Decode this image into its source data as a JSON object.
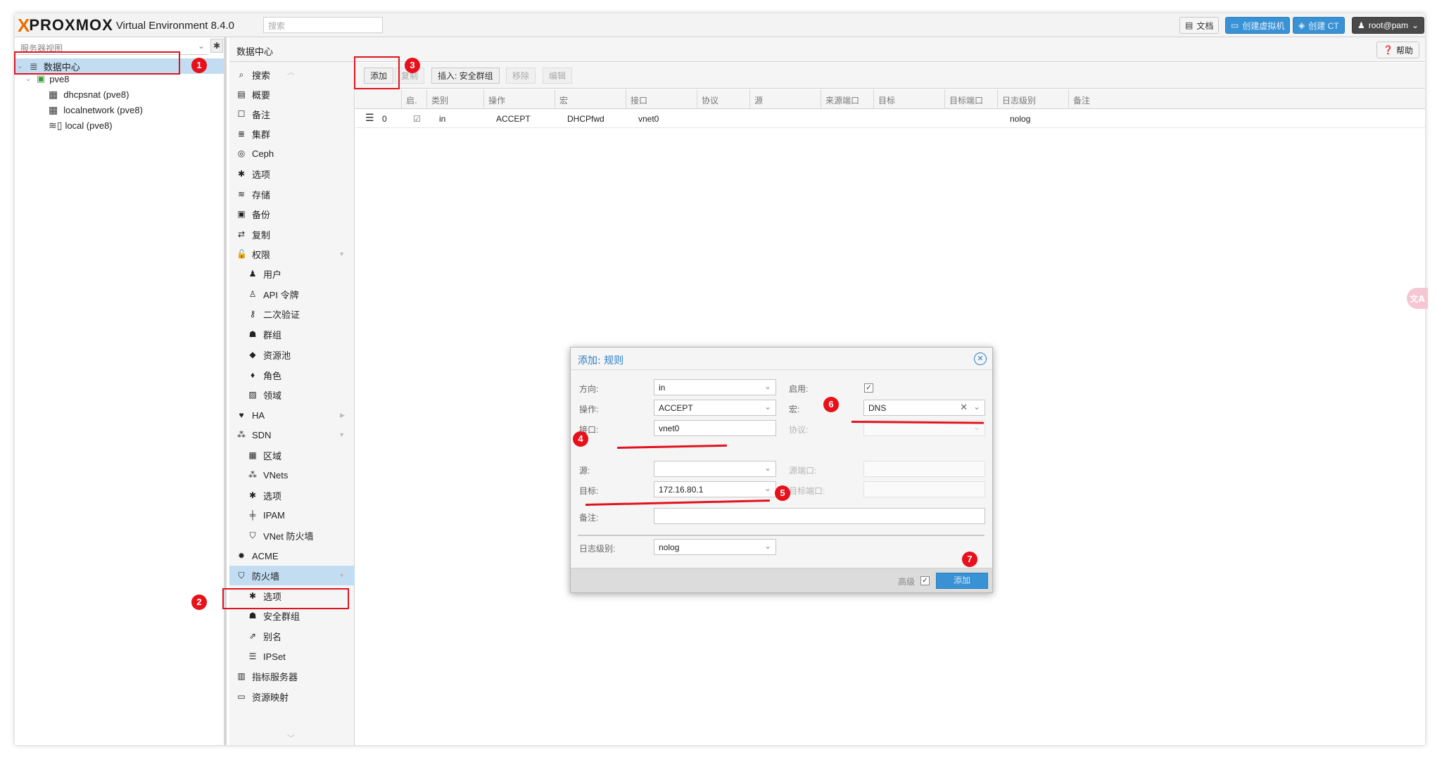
{
  "topbar": {
    "logo_x": "X",
    "logo_text": "PROXMOX",
    "version": "Virtual Environment 8.4.0",
    "search_placeholder": "搜索",
    "docs_label": "文档",
    "create_vm_label": "创建虚拟机",
    "create_ct_label": "创建 CT",
    "user_label": "root@pam"
  },
  "left_tree": {
    "view_label": "服务器视图",
    "items": [
      {
        "label": "数据中心",
        "icon": "datacenter-icon"
      },
      {
        "label": "pve8",
        "icon": "node-icon"
      },
      {
        "label": "dhcpsnat (pve8)",
        "icon": "sdn-zone-icon"
      },
      {
        "label": "localnetwork (pve8)",
        "icon": "sdn-zone-icon"
      },
      {
        "label": "local (pve8)",
        "icon": "storage-icon"
      }
    ]
  },
  "content": {
    "title": "数据中心",
    "help_label": "帮助"
  },
  "nav": {
    "items": [
      {
        "label": "搜索",
        "icon": "search-icon",
        "glyph": "⌕"
      },
      {
        "label": "概要",
        "icon": "book-icon",
        "glyph": "▤"
      },
      {
        "label": "备注",
        "icon": "notes-icon",
        "glyph": "☐"
      },
      {
        "label": "集群",
        "icon": "server-icon",
        "glyph": "≣"
      },
      {
        "label": "Ceph",
        "icon": "ceph-icon",
        "glyph": "◎"
      },
      {
        "label": "选项",
        "icon": "gear-icon",
        "glyph": "✱"
      },
      {
        "label": "存储",
        "icon": "database-icon",
        "glyph": "≋"
      },
      {
        "label": "备份",
        "icon": "floppy-icon",
        "glyph": "▣"
      },
      {
        "label": "复制",
        "icon": "retweet-icon",
        "glyph": "⇄"
      },
      {
        "label": "权限",
        "icon": "unlock-icon",
        "glyph": "🔓"
      },
      {
        "label": "用户",
        "icon": "user-icon",
        "glyph": "♟"
      },
      {
        "label": "API 令牌",
        "icon": "user-outline-icon",
        "glyph": "♙"
      },
      {
        "label": "二次验证",
        "icon": "key-icon",
        "glyph": "⚷"
      },
      {
        "label": "群组",
        "icon": "users-icon",
        "glyph": "☗"
      },
      {
        "label": "资源池",
        "icon": "tags-icon",
        "glyph": "◆"
      },
      {
        "label": "角色",
        "icon": "male-icon",
        "glyph": "♦"
      },
      {
        "label": "领域",
        "icon": "address-book-icon",
        "glyph": "▨"
      },
      {
        "label": "HA",
        "icon": "heartbeat-icon",
        "glyph": "♥"
      },
      {
        "label": "SDN",
        "icon": "sdn-icon",
        "glyph": "⁂"
      },
      {
        "label": "区域",
        "icon": "th-icon",
        "glyph": "▦"
      },
      {
        "label": "VNets",
        "icon": "network-icon",
        "glyph": "⁂"
      },
      {
        "label": "选项",
        "icon": "gear-icon",
        "glyph": "✱"
      },
      {
        "label": "IPAM",
        "icon": "ipam-icon",
        "glyph": "╪"
      },
      {
        "label": "VNet 防火墙",
        "icon": "shield-icon",
        "glyph": "⛉"
      },
      {
        "label": "ACME",
        "icon": "certificate-icon",
        "glyph": "✹"
      },
      {
        "label": "防火墙",
        "icon": "shield-icon",
        "glyph": "⛉"
      },
      {
        "label": "选项",
        "icon": "gear-icon",
        "glyph": "✱"
      },
      {
        "label": "安全群组",
        "icon": "users-icon",
        "glyph": "☗"
      },
      {
        "label": "别名",
        "icon": "external-link-icon",
        "glyph": "⇗"
      },
      {
        "label": "IPSet",
        "icon": "list-icon",
        "glyph": "☰"
      },
      {
        "label": "指标服务器",
        "icon": "bar-chart-icon",
        "glyph": "▥"
      },
      {
        "label": "资源映射",
        "icon": "folder-icon",
        "glyph": "▭"
      }
    ]
  },
  "toolbar": {
    "add": "添加",
    "copy": "复制",
    "insert_group": "插入: 安全群组",
    "remove": "移除",
    "edit": "编辑"
  },
  "grid": {
    "headers": [
      "启.",
      "类别",
      "操作",
      "宏",
      "接口",
      "协议",
      "源",
      "来源端口",
      "目标",
      "目标端口",
      "日志级别",
      "备注"
    ],
    "rows": [
      {
        "pos": "0",
        "enabled": "☑",
        "type": "in",
        "action": "ACCEPT",
        "macro": "DHCPfwd",
        "iface": "vnet0",
        "proto": "",
        "source": "",
        "sport": "",
        "dest": "",
        "dport": "",
        "log": "nolog",
        "comment": ""
      }
    ]
  },
  "dialog": {
    "title": "添加: 规则",
    "direction_label": "方向:",
    "direction_value": "in",
    "action_label": "操作:",
    "action_value": "ACCEPT",
    "interface_label": "接口:",
    "interface_value": "vnet0",
    "source_label": "源:",
    "source_value": "",
    "dest_label": "目标:",
    "dest_value": "172.16.80.1",
    "comment_label": "备注:",
    "comment_value": "",
    "enable_label": "启用:",
    "macro_label": "宏:",
    "macro_value": "DNS",
    "protocol_label": "协议:",
    "sport_label": "源端口:",
    "dport_label": "目标端口:",
    "log_label": "日志级别:",
    "log_value": "nolog",
    "advanced_label": "高级",
    "add_button": "添加"
  },
  "annotations": {
    "badges": [
      "1",
      "2",
      "3",
      "4",
      "5",
      "6",
      "7"
    ]
  },
  "translator_bubble": "文A",
  "colors": {
    "accent_blue": "#3892d4",
    "selection": "#c2ddf2",
    "annotation_red": "#e0141e",
    "logo_orange": "#e57000"
  }
}
